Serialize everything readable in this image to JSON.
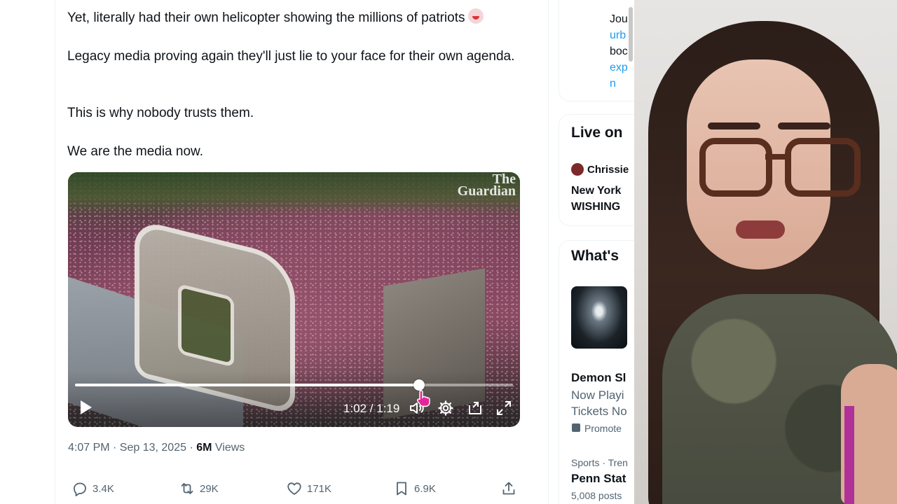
{
  "tweet": {
    "lines": [
      "Yet, literally had their own helicopter showing the millions of patriots",
      "Legacy media proving again they'll just lie to your face for their own agenda.",
      "This is why nobody trusts them.",
      "We are the media now."
    ],
    "emoji_icon": "clown-face-emoji"
  },
  "video": {
    "watermark_line1": "The",
    "watermark_line2": "Guardian",
    "time_readout": "1:02 / 1:19",
    "progress_fraction": 0.785
  },
  "meta": {
    "timestamp": "4:07 PM · Sep 13, 2025 · ",
    "views_count": "6M",
    "views_label": " Views"
  },
  "actions": {
    "replies": "3.4K",
    "reposts": "29K",
    "likes": "171K",
    "bookmarks": "6.9K"
  },
  "sidebar": {
    "card_a": [
      "Jou",
      "urb",
      "boc",
      "exp",
      "n"
    ],
    "live_heading": "Live on",
    "live_user": "Chrissie",
    "live_title_1": "New York",
    "live_title_2": "WISHING",
    "whats_heading": "What's",
    "trend1_title": "Demon Sl",
    "trend1_sub1": "Now Playi",
    "trend1_sub2": "Tickets No",
    "trend1_promo": "Promote",
    "trend2_category": "Sports · Tren",
    "trend2_title": "Penn Stat",
    "trend2_posts": "5,008 posts"
  },
  "colors": {
    "text": "#0f1419",
    "secondary": "#536471",
    "link": "#1d9bf0"
  }
}
